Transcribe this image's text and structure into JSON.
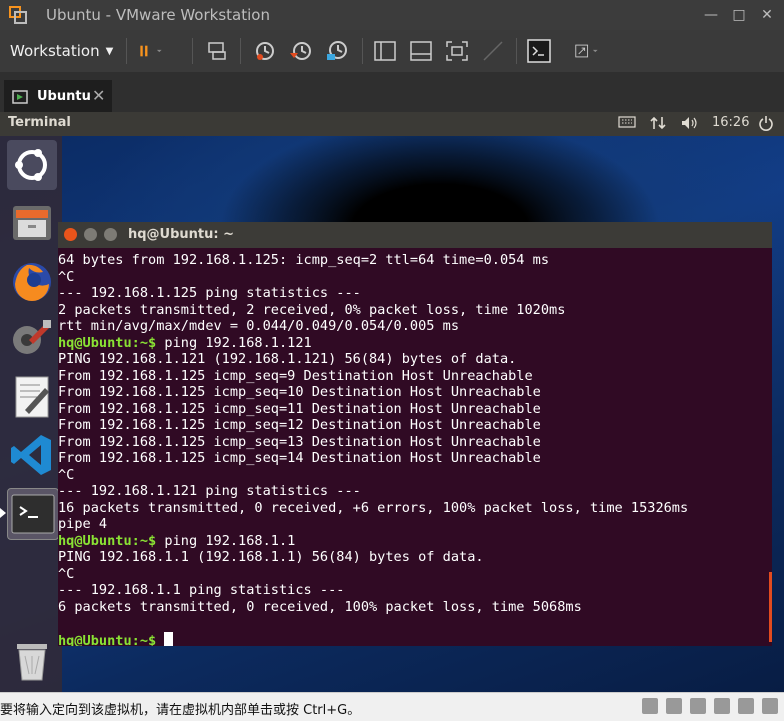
{
  "window": {
    "title": "Ubuntu - VMware Workstation"
  },
  "toolbar": {
    "workstation_menu": "Workstation"
  },
  "tabs": [
    {
      "label": "Ubuntu"
    }
  ],
  "ubuntu_panel": {
    "app_name": "Terminal",
    "clock": "16:26"
  },
  "terminal": {
    "title": "hq@Ubuntu: ~",
    "lines": [
      {
        "text": "64 bytes from 192.168.1.125: icmp_seq=2 ttl=64 time=0.054 ms"
      },
      {
        "text": "^C"
      },
      {
        "text": "--- 192.168.1.125 ping statistics ---"
      },
      {
        "text": "2 packets transmitted, 2 received, 0% packet loss, time 1020ms"
      },
      {
        "text": "rtt min/avg/max/mdev = 0.044/0.049/0.054/0.005 ms"
      },
      {
        "prompt": "hq@Ubuntu:~$",
        "text": " ping 192.168.1.121"
      },
      {
        "text": "PING 192.168.1.121 (192.168.1.121) 56(84) bytes of data."
      },
      {
        "text": "From 192.168.1.125 icmp_seq=9 Destination Host Unreachable"
      },
      {
        "text": "From 192.168.1.125 icmp_seq=10 Destination Host Unreachable"
      },
      {
        "text": "From 192.168.1.125 icmp_seq=11 Destination Host Unreachable"
      },
      {
        "text": "From 192.168.1.125 icmp_seq=12 Destination Host Unreachable"
      },
      {
        "text": "From 192.168.1.125 icmp_seq=13 Destination Host Unreachable"
      },
      {
        "text": "From 192.168.1.125 icmp_seq=14 Destination Host Unreachable"
      },
      {
        "text": "^C"
      },
      {
        "text": "--- 192.168.1.121 ping statistics ---"
      },
      {
        "text": "16 packets transmitted, 0 received, +6 errors, 100% packet loss, time 15326ms"
      },
      {
        "text": "pipe 4"
      },
      {
        "prompt": "hq@Ubuntu:~$",
        "text": " ping 192.168.1.1"
      },
      {
        "text": "PING 192.168.1.1 (192.168.1.1) 56(84) bytes of data."
      },
      {
        "text": "^C"
      },
      {
        "text": "--- 192.168.1.1 ping statistics ---"
      },
      {
        "text": "6 packets transmitted, 0 received, 100% packet loss, time 5068ms"
      },
      {
        "text": ""
      },
      {
        "prompt": "hq@Ubuntu:~$",
        "text": " ",
        "cursor": true
      }
    ]
  },
  "statusbar": {
    "message": "要将输入定向到该虚拟机，请在虚拟机内部单击或按 Ctrl+G。"
  },
  "launcher": [
    {
      "name": "ubuntu-dash-icon"
    },
    {
      "name": "files-icon"
    },
    {
      "name": "firefox-icon"
    },
    {
      "name": "system-settings-icon"
    },
    {
      "name": "text-editor-icon"
    },
    {
      "name": "vscode-icon"
    },
    {
      "name": "terminal-icon"
    },
    {
      "name": "trash-icon"
    }
  ],
  "colors": {
    "terminal_bg": "#300a24",
    "prompt": "#8ae234",
    "ubuntu_panel": "#3b3a36",
    "vm_pause": "#f7931e"
  }
}
